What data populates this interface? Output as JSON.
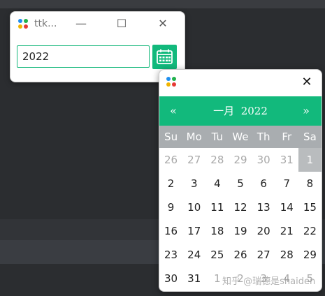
{
  "main_window": {
    "title": "ttk...",
    "minimize": "—",
    "maximize": "☐",
    "close": "✕",
    "date_value": "2022",
    "calendar_button_icon": "calendar-icon"
  },
  "calendar": {
    "close": "✕",
    "prev_label": "«",
    "next_label": "»",
    "month": "一月",
    "year": "2022",
    "weekdays": [
      "Su",
      "Mo",
      "Tu",
      "We",
      "Th",
      "Fr",
      "Sa"
    ],
    "weeks": [
      [
        "26",
        "27",
        "28",
        "29",
        "30",
        "31",
        "1"
      ],
      [
        "2",
        "3",
        "4",
        "5",
        "6",
        "7",
        "8"
      ],
      [
        "9",
        "10",
        "11",
        "12",
        "13",
        "14",
        "15"
      ],
      [
        "16",
        "17",
        "18",
        "19",
        "20",
        "21",
        "22"
      ],
      [
        "23",
        "24",
        "25",
        "26",
        "27",
        "28",
        "29"
      ],
      [
        "30",
        "31",
        "1",
        "2",
        "3",
        "4",
        "5"
      ]
    ],
    "other_month": [
      [
        true,
        true,
        true,
        true,
        true,
        true,
        false
      ],
      [
        false,
        false,
        false,
        false,
        false,
        false,
        false
      ],
      [
        false,
        false,
        false,
        false,
        false,
        false,
        false
      ],
      [
        false,
        false,
        false,
        false,
        false,
        false,
        false
      ],
      [
        false,
        false,
        false,
        false,
        false,
        false,
        false
      ],
      [
        false,
        false,
        true,
        true,
        true,
        true,
        true
      ]
    ],
    "selected_day": "1"
  },
  "watermark": "知乎 @瑞德是shaiden",
  "colors": {
    "accent": "#12b97c",
    "weekday_bar": "#a9adb0",
    "selected": "#b9bcbe"
  }
}
